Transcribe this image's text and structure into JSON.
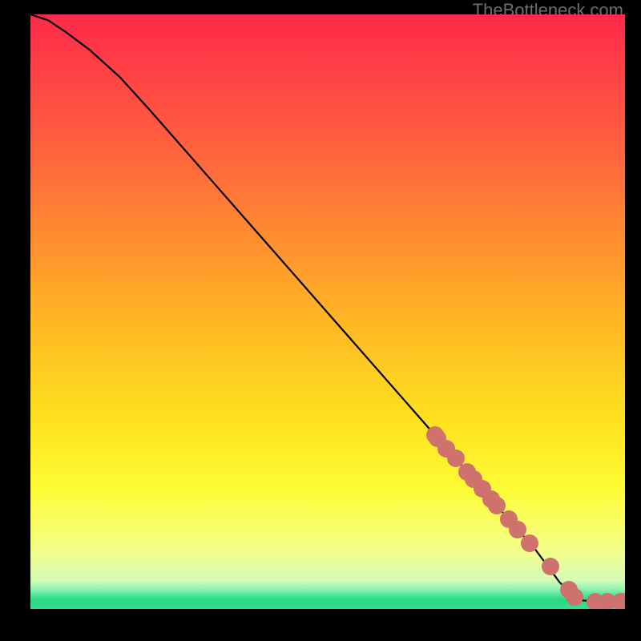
{
  "attribution": "TheBottleneck.com",
  "chart_data": {
    "type": "line",
    "title": "",
    "xlabel": "",
    "ylabel": "",
    "xlim": [
      0,
      100
    ],
    "ylim": [
      0,
      100
    ],
    "grid": false,
    "legend": false,
    "series": [
      {
        "name": "curve",
        "type": "line",
        "color": "#000000",
        "x": [
          0,
          3,
          6,
          10,
          15,
          20,
          25,
          30,
          35,
          40,
          45,
          50,
          55,
          60,
          65,
          70,
          75,
          80,
          85,
          89,
          92,
          96,
          100
        ],
        "y": [
          100,
          99,
          97,
          94,
          89.5,
          84,
          78.3,
          72.6,
          66.9,
          61.2,
          55.5,
          49.8,
          44.1,
          38.4,
          32.7,
          27.0,
          21.3,
          15.6,
          9.9,
          4.5,
          1.5,
          1.2,
          1.2
        ]
      },
      {
        "name": "markers",
        "type": "scatter",
        "color": "#cf726d",
        "x": [
          68.0,
          68.5,
          70.0,
          71.5,
          73.5,
          74.5,
          76.0,
          77.5,
          78.5,
          80.5,
          82.0,
          84.0,
          87.5,
          90.5,
          91.5,
          95.0,
          97.0,
          99.3,
          100.0
        ],
        "y": [
          29.3,
          28.7,
          27.0,
          25.3,
          23.1,
          21.9,
          20.2,
          18.5,
          17.4,
          15.1,
          13.4,
          11.1,
          7.1,
          3.2,
          2.0,
          1.2,
          1.2,
          1.2,
          1.2
        ]
      }
    ],
    "background": {
      "type": "vertical-gradient",
      "stops": [
        {
          "pos": 0.0,
          "color": "#ff294b"
        },
        {
          "pos": 0.26,
          "color": "#ff6b3b"
        },
        {
          "pos": 0.5,
          "color": "#ffb225"
        },
        {
          "pos": 0.69,
          "color": "#fee31e"
        },
        {
          "pos": 0.8,
          "color": "#fdfc36"
        },
        {
          "pos": 0.9,
          "color": "#f4ff88"
        },
        {
          "pos": 0.951,
          "color": "#d6fbb6"
        },
        {
          "pos": 0.965,
          "color": "#9bf5b4"
        },
        {
          "pos": 0.975,
          "color": "#56e99c"
        },
        {
          "pos": 0.985,
          "color": "#2bd884"
        },
        {
          "pos": 1.0,
          "color": "#35de8d"
        }
      ]
    }
  }
}
